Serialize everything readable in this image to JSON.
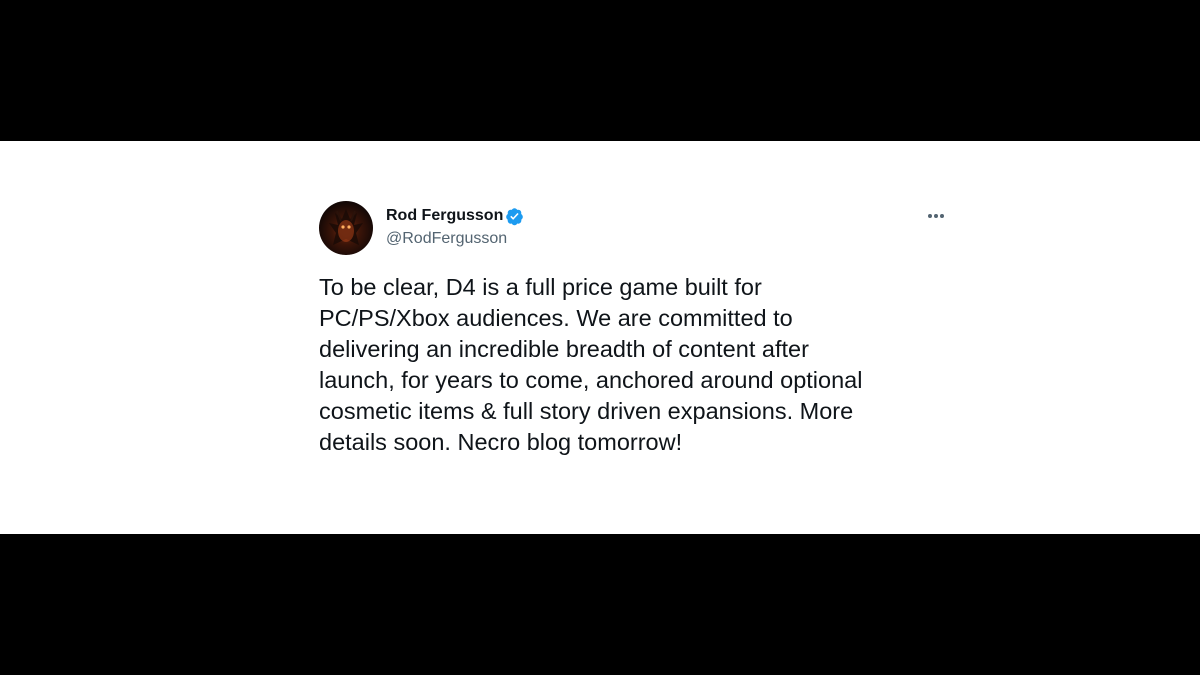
{
  "tweet": {
    "author": {
      "name": "Rod Fergusson",
      "handle": "@RodFergusson",
      "verified": true,
      "avatar_icon": "demon-avatar-icon"
    },
    "more_icon": "more-dots-icon",
    "text_lines": [
      "To be clear, D4 is a full price game built for",
      "PC/PS/Xbox audiences. We are committed to",
      "delivering an incredible breadth of content after",
      "launch, for years to come, anchored around optional",
      "cosmetic items & full story driven expansions. More",
      "details soon. Necro blog tomorrow!"
    ]
  },
  "colors": {
    "background": "#000000",
    "card": "#ffffff",
    "text": "#0f1419",
    "secondary": "#536471",
    "verified": "#1d9bf0"
  }
}
